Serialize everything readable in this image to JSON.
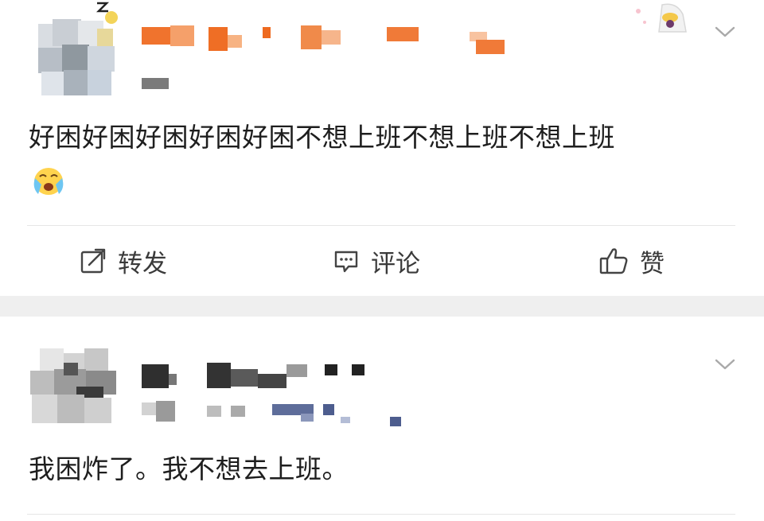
{
  "posts": [
    {
      "text": "好困好困好困好困好困不想上班不想上班不想上班",
      "emoji": "crying-face",
      "actions": {
        "repost_label": "转发",
        "comment_label": "评论",
        "like_label": "赞"
      }
    },
    {
      "text": "我困炸了。我不想去上班。"
    }
  ],
  "colors": {
    "username_mosaic": "#f0732d",
    "separator_band": "#efefef",
    "divider": "#e6e6e6",
    "action_text": "#3a3a3a"
  },
  "icons": {
    "repost": "repost-icon",
    "comment": "comment-icon",
    "like": "thumbs-up-icon",
    "menu": "chevron-down-icon"
  }
}
